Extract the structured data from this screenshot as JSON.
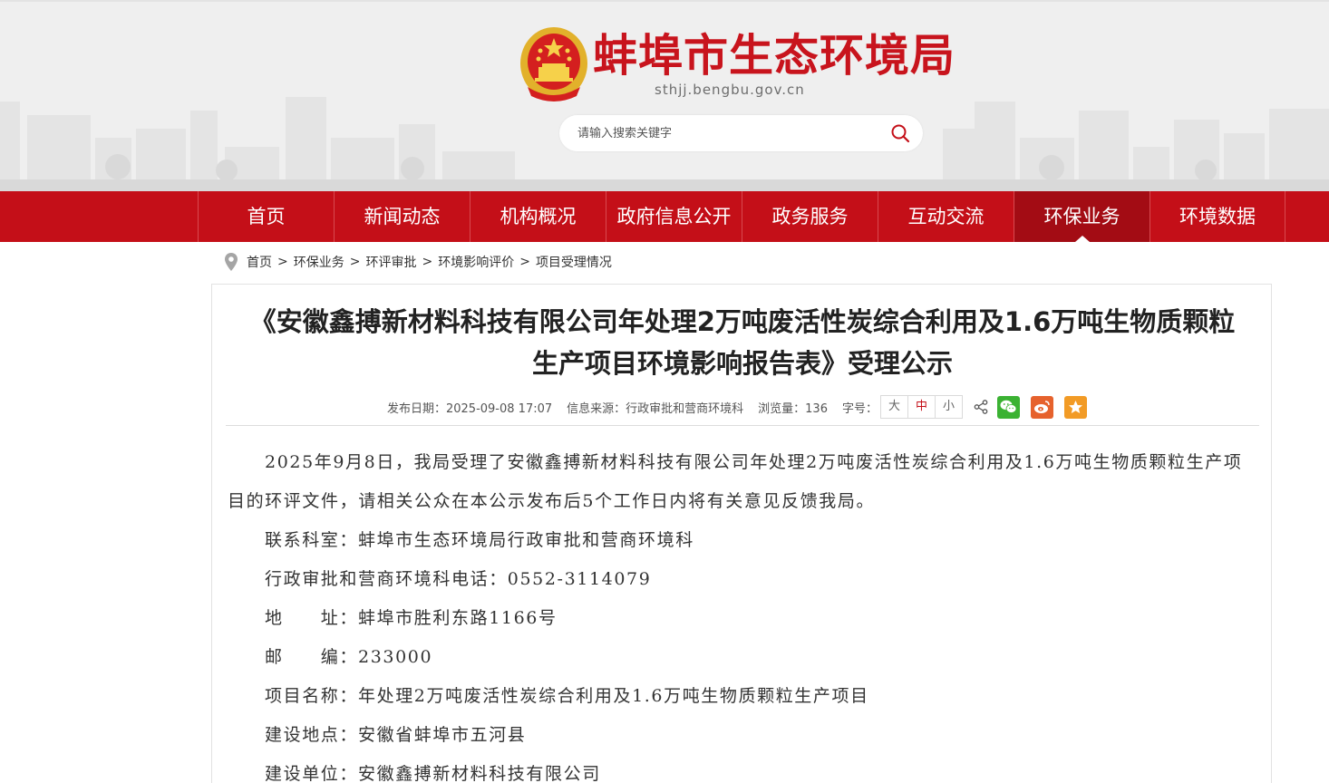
{
  "site": {
    "title": "蚌埠市生态环境局",
    "domain": "sthjj.bengbu.gov.cn"
  },
  "search": {
    "placeholder": "请输入搜索关键字"
  },
  "nav": {
    "items": [
      {
        "label": "首页"
      },
      {
        "label": "新闻动态"
      },
      {
        "label": "机构概况"
      },
      {
        "label": "政府信息公开"
      },
      {
        "label": "政务服务"
      },
      {
        "label": "互动交流"
      },
      {
        "label": "环保业务",
        "active": true
      },
      {
        "label": "环境数据"
      }
    ]
  },
  "breadcrumb": [
    "首页",
    "环保业务",
    "环评审批",
    "环境影响评价",
    "项目受理情况"
  ],
  "breadcrumb_separator": ">",
  "article": {
    "title_line1": "《安徽鑫搏新材料科技有限公司年处理2万吨废活性炭综合利用及1.6万吨生物质颗粒",
    "title_line2": "生产项目环境影响报告表》受理公示",
    "meta": {
      "date": "发布日期：2025-09-08 17:07",
      "source": "信息来源：行政审批和营商环境科",
      "views": "浏览量：136",
      "fontsize_label": "字号：",
      "fontsize_options": [
        "大",
        "中",
        "小"
      ]
    },
    "body": [
      "2025年9月8日，我局受理了安徽鑫搏新材料科技有限公司年处理2万吨废活性炭综合利用及1.6万吨生物质颗粒生产项目的环评文件，请相关公众在本公示发布后5个工作日内将有关意见反馈我局。",
      "联系科室：蚌埠市生态环境局行政审批和营商环境科",
      "行政审批和营商环境科电话：0552-3114079",
      "地　　址：蚌埠市胜利东路1166号",
      "邮　　编：233000",
      "项目名称：年处理2万吨废活性炭综合利用及1.6万吨生物质颗粒生产项目",
      "建设地点：安徽省蚌埠市五河县",
      "建设单位：安徽鑫搏新材料科技有限公司"
    ]
  },
  "colors": {
    "brand_red": "#c40f18",
    "nav_active": "#a30c14",
    "wechat": "#3bb233",
    "weibo": "#e6622d",
    "favorite": "#f29b26"
  },
  "icons": [
    "emblem-icon",
    "search-icon",
    "location-pin-icon",
    "share-icon",
    "wechat-icon",
    "weibo-icon",
    "favorite-icon"
  ]
}
